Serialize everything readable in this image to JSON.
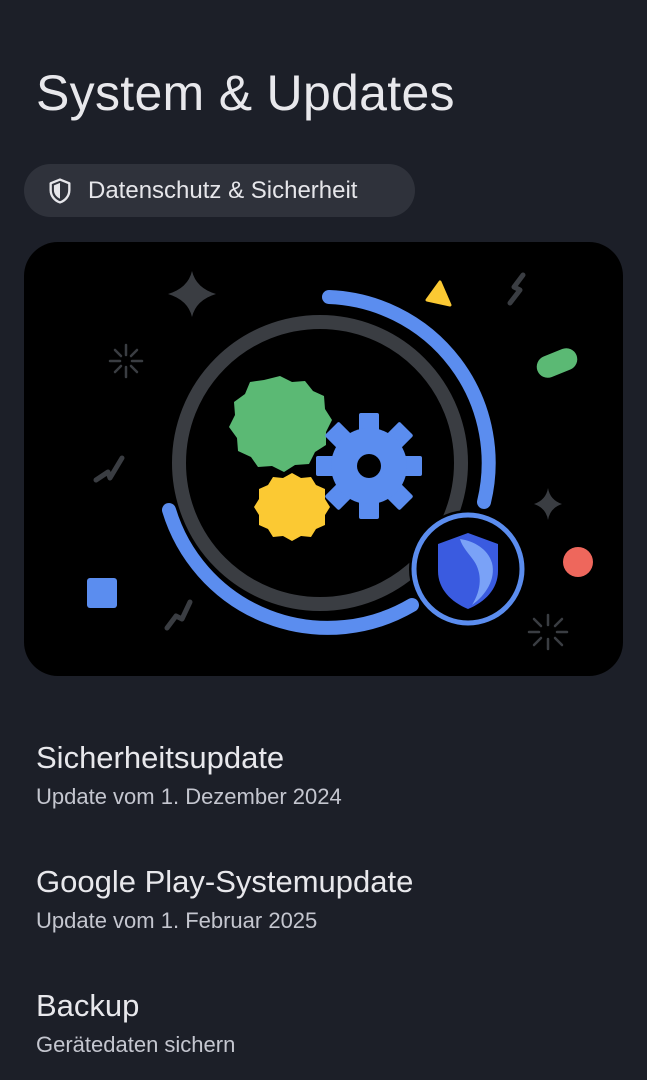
{
  "page": {
    "title": "System & Updates"
  },
  "chip": {
    "label": "Datenschutz & Sicherheit",
    "icon": "shield-icon"
  },
  "illustration": {
    "name": "system-updates-illustration",
    "colors": {
      "background": "#000000",
      "ring_track": "#3a3d42",
      "ring_progress": "#5b8def",
      "gear": "#5b8def",
      "green_badge": "#5bb974",
      "yellow_badge": "#fbc933",
      "shield_dark": "#3a5be0",
      "shield_light": "#7aa2f7",
      "red_dot": "#ee675c",
      "accent_yellow": "#fbc933",
      "accent_green": "#5bb974",
      "accent_blue": "#5b8def"
    }
  },
  "items": [
    {
      "title": "Sicherheitsupdate",
      "subtitle": "Update vom 1. Dezember 2024"
    },
    {
      "title": "Google Play-Systemupdate",
      "subtitle": "Update vom 1. Februar 2025"
    },
    {
      "title": "Backup",
      "subtitle": "Gerätedaten sichern"
    }
  ],
  "theme": {
    "background": "#1c1f28",
    "chip_background": "#2f323b",
    "text_primary": "#e8e8ec",
    "text_secondary": "#c4c6cf"
  }
}
